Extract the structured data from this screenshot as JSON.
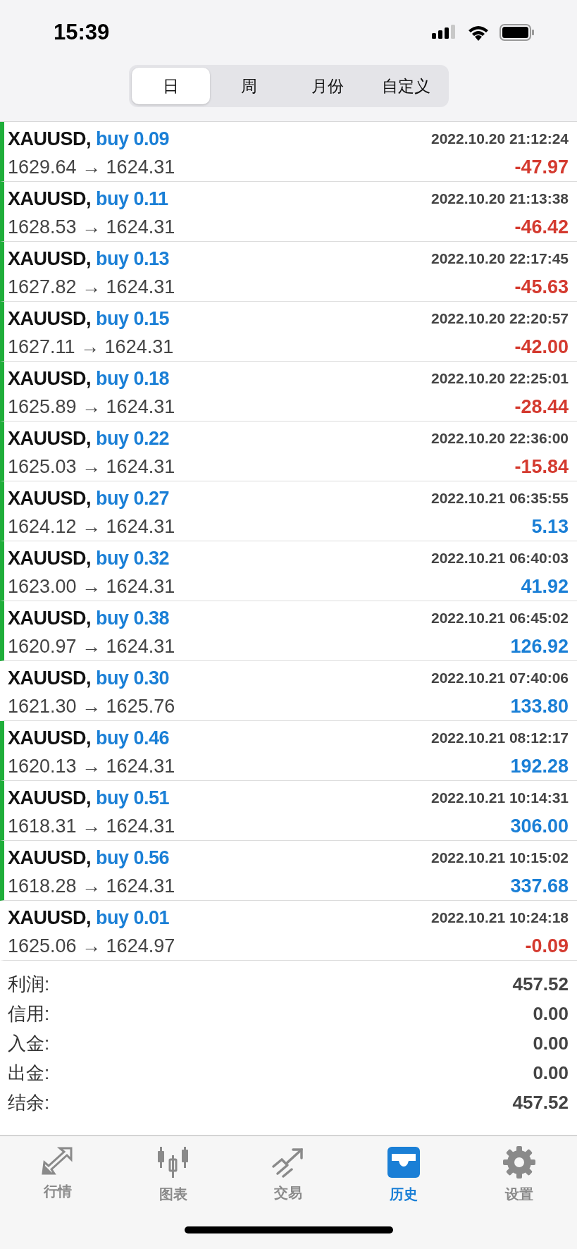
{
  "status_bar": {
    "time": "15:39"
  },
  "period_tabs": [
    {
      "label": "日",
      "selected": true
    },
    {
      "label": "周",
      "selected": false
    },
    {
      "label": "月份",
      "selected": false
    },
    {
      "label": "自定义",
      "selected": false
    }
  ],
  "deals": [
    {
      "symbol": "XAUUSD,",
      "side": "buy 0.09",
      "time": "2022.10.20 21:12:24",
      "prices": "1629.64 → 1624.31",
      "profit": "-47.97",
      "kind": "loss",
      "flagged": true
    },
    {
      "symbol": "XAUUSD,",
      "side": "buy 0.11",
      "time": "2022.10.20 21:13:38",
      "prices": "1628.53 → 1624.31",
      "profit": "-46.42",
      "kind": "loss",
      "flagged": true
    },
    {
      "symbol": "XAUUSD,",
      "side": "buy 0.13",
      "time": "2022.10.20 22:17:45",
      "prices": "1627.82 → 1624.31",
      "profit": "-45.63",
      "kind": "loss",
      "flagged": true
    },
    {
      "symbol": "XAUUSD,",
      "side": "buy 0.15",
      "time": "2022.10.20 22:20:57",
      "prices": "1627.11 → 1624.31",
      "profit": "-42.00",
      "kind": "loss",
      "flagged": true
    },
    {
      "symbol": "XAUUSD,",
      "side": "buy 0.18",
      "time": "2022.10.20 22:25:01",
      "prices": "1625.89 → 1624.31",
      "profit": "-28.44",
      "kind": "loss",
      "flagged": true
    },
    {
      "symbol": "XAUUSD,",
      "side": "buy 0.22",
      "time": "2022.10.20 22:36:00",
      "prices": "1625.03 → 1624.31",
      "profit": "-15.84",
      "kind": "loss",
      "flagged": true
    },
    {
      "symbol": "XAUUSD,",
      "side": "buy 0.27",
      "time": "2022.10.21 06:35:55",
      "prices": "1624.12 → 1624.31",
      "profit": "5.13",
      "kind": "profit",
      "flagged": true
    },
    {
      "symbol": "XAUUSD,",
      "side": "buy 0.32",
      "time": "2022.10.21 06:40:03",
      "prices": "1623.00 → 1624.31",
      "profit": "41.92",
      "kind": "profit",
      "flagged": true
    },
    {
      "symbol": "XAUUSD,",
      "side": "buy 0.38",
      "time": "2022.10.21 06:45:02",
      "prices": "1620.97 → 1624.31",
      "profit": "126.92",
      "kind": "profit",
      "flagged": true
    },
    {
      "symbol": "XAUUSD,",
      "side": "buy 0.30",
      "time": "2022.10.21 07:40:06",
      "prices": "1621.30 → 1625.76",
      "profit": "133.80",
      "kind": "profit",
      "flagged": false
    },
    {
      "symbol": "XAUUSD,",
      "side": "buy 0.46",
      "time": "2022.10.21 08:12:17",
      "prices": "1620.13 → 1624.31",
      "profit": "192.28",
      "kind": "profit",
      "flagged": true
    },
    {
      "symbol": "XAUUSD,",
      "side": "buy 0.51",
      "time": "2022.10.21 10:14:31",
      "prices": "1618.31 → 1624.31",
      "profit": "306.00",
      "kind": "profit",
      "flagged": true
    },
    {
      "symbol": "XAUUSD,",
      "side": "buy 0.56",
      "time": "2022.10.21 10:15:02",
      "prices": "1618.28 → 1624.31",
      "profit": "337.68",
      "kind": "profit",
      "flagged": true
    },
    {
      "symbol": "XAUUSD,",
      "side": "buy 0.01",
      "time": "2022.10.21 10:24:18",
      "prices": "1625.06 → 1624.97",
      "profit": "-0.09",
      "kind": "loss",
      "flagged": false
    }
  ],
  "summary": [
    {
      "label": "利润:",
      "value": "457.52"
    },
    {
      "label": "信用:",
      "value": "0.00"
    },
    {
      "label": "入金:",
      "value": "0.00"
    },
    {
      "label": "出金:",
      "value": "0.00"
    },
    {
      "label": "结余:",
      "value": "457.52"
    }
  ],
  "nav": [
    {
      "label": "行情",
      "kind": "quotes",
      "selected": false
    },
    {
      "label": "图表",
      "kind": "chart",
      "selected": false
    },
    {
      "label": "交易",
      "kind": "trade",
      "selected": false
    },
    {
      "label": "历史",
      "kind": "history",
      "selected": true
    },
    {
      "label": "设置",
      "kind": "settings",
      "selected": false
    }
  ]
}
